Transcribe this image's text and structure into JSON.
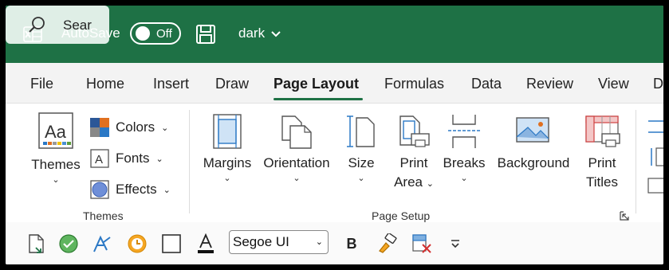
{
  "titlebar": {
    "autosave_label": "AutoSave",
    "autosave_state": "Off",
    "file_name": "dark",
    "search_placeholder": "Sear"
  },
  "tabs": [
    {
      "label": "File"
    },
    {
      "label": "Home"
    },
    {
      "label": "Insert"
    },
    {
      "label": "Draw"
    },
    {
      "label": "Page Layout",
      "active": true
    },
    {
      "label": "Formulas"
    },
    {
      "label": "Data"
    },
    {
      "label": "Review"
    },
    {
      "label": "View"
    },
    {
      "label": "D"
    }
  ],
  "ribbon": {
    "themes_group": {
      "label": "Themes",
      "themes_button": "Themes",
      "colors": "Colors",
      "fonts": "Fonts",
      "effects": "Effects"
    },
    "page_setup_group": {
      "label": "Page Setup",
      "margins": "Margins",
      "orientation": "Orientation",
      "size": "Size",
      "print_area_line1": "Print",
      "print_area_line2": "Area",
      "breaks": "Breaks",
      "background": "Background",
      "print_titles_line1": "Print",
      "print_titles_line2": "Titles"
    }
  },
  "qat": {
    "font_name": "Segoe UI",
    "bold": "B"
  },
  "colors": {
    "brand_green": "#1e7145",
    "accent_blue": "#2b78c5"
  }
}
